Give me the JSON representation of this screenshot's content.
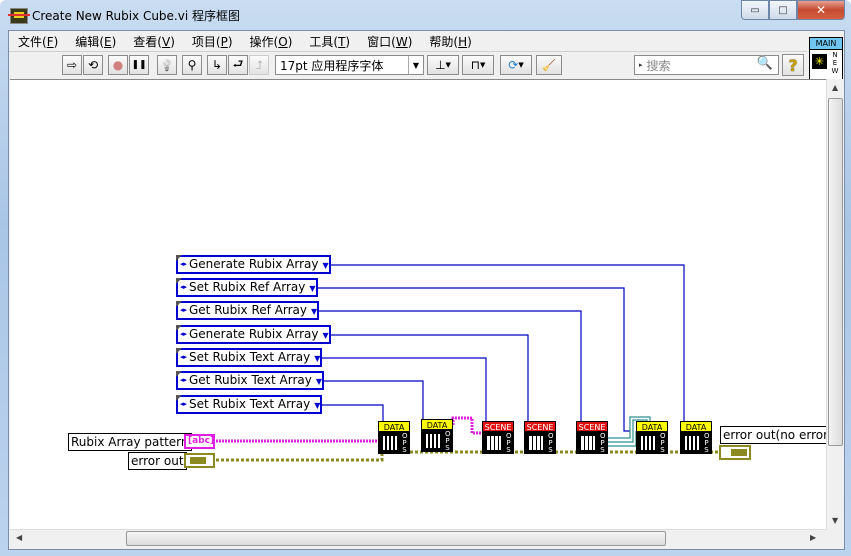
{
  "window": {
    "title": "Create New Rubix Cube.vi 程序框图",
    "controls": {
      "minimize": "▭",
      "maximize": "□",
      "close": "✕"
    }
  },
  "menu": [
    {
      "label": "文件",
      "key": "F"
    },
    {
      "label": "编辑",
      "key": "E"
    },
    {
      "label": "查看",
      "key": "V"
    },
    {
      "label": "项目",
      "key": "P"
    },
    {
      "label": "操作",
      "key": "O"
    },
    {
      "label": "工具",
      "key": "T"
    },
    {
      "label": "窗口",
      "key": "W"
    },
    {
      "label": "帮助",
      "key": "H"
    }
  ],
  "toolbar": {
    "run_icon": "⇨",
    "run_continuous_icon": "⟲",
    "abort_icon": "●",
    "pause_icon": "❚❚",
    "highlight_icon": "💡",
    "retain_values_icon": "⚲",
    "step_into_icon": "↳",
    "step_over_icon": "⮐",
    "step_out_icon": "⮥",
    "font_select": "17pt 应用程序字体",
    "align_icon": "⊥",
    "distribute_icon": "⊓",
    "reorder_icon": "⟳",
    "cleanup_icon": "🧹",
    "search_placeholder": "搜索",
    "help_icon": "?"
  },
  "vi_icon": {
    "top": "MAIN",
    "symbol": "✳",
    "side": [
      "N",
      "E",
      "W"
    ]
  },
  "diagram": {
    "enums": [
      "Generate Rubix Array",
      "Set Rubix Ref Array",
      "Get Rubix Ref Array",
      "Generate Rubix Array",
      "Set Rubix Text Array",
      "Get Rubix Text Array",
      "Set Rubix Text Array"
    ],
    "controls": {
      "pattern_label": "Rubix Array pattern",
      "pattern_glyph": "[abc]",
      "error_label": "error out"
    },
    "nodes": [
      {
        "type": "data",
        "header": "DATA",
        "side": "OPS"
      },
      {
        "type": "data",
        "header": "DATA",
        "side": "OPS"
      },
      {
        "type": "scene",
        "header": "SCENE",
        "side": "OPS"
      },
      {
        "type": "scene",
        "header": "SCENE",
        "side": "OPS"
      },
      {
        "type": "scene",
        "header": "SCENE",
        "side": "OPS"
      },
      {
        "type": "data",
        "header": "DATA",
        "side": "OPS"
      },
      {
        "type": "data",
        "header": "DATA",
        "side": "OPS"
      }
    ],
    "indicator": {
      "label": "error out(no error"
    },
    "colors": {
      "enum_wire": "#0000c0",
      "string_wire": "#e020e0",
      "error_wire": "#8a8a20",
      "ref_wire": "#2a9090"
    }
  }
}
